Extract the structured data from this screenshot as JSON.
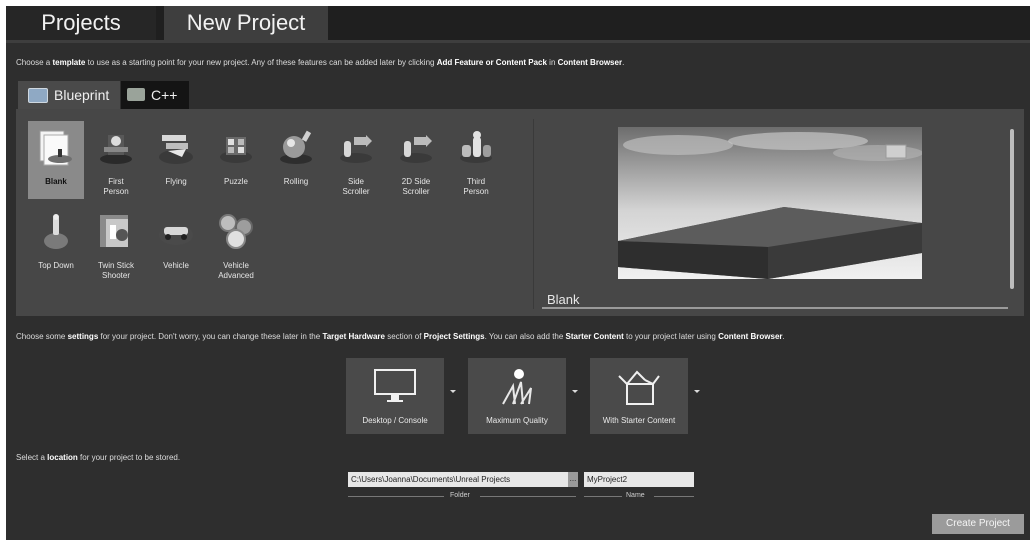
{
  "tabs": {
    "projects": "Projects",
    "new_project": "New Project"
  },
  "template_instruction": {
    "pre": "Choose a ",
    "b1": "template",
    "mid": " to use as a starting point for your new project.  Any of these features can be added later by clicking ",
    "b2": "Add Feature or Content Pack",
    "mid2": " in ",
    "b3": "Content Browser",
    "post": "."
  },
  "template_tabs": {
    "blueprint": "Blueprint",
    "cpp": "C++"
  },
  "templates": {
    "blank": {
      "line1": "Blank",
      "line2": ""
    },
    "first_person": {
      "line1": "First",
      "line2": "Person"
    },
    "flying": {
      "line1": "Flying",
      "line2": ""
    },
    "puzzle": {
      "line1": "Puzzle",
      "line2": ""
    },
    "rolling": {
      "line1": "Rolling",
      "line2": ""
    },
    "side_scroller": {
      "line1": "Side",
      "line2": "Scroller"
    },
    "side_scroller_2d": {
      "line1": "2D Side",
      "line2": "Scroller"
    },
    "third_person": {
      "line1": "Third",
      "line2": "Person"
    },
    "top_down": {
      "line1": "Top Down",
      "line2": ""
    },
    "twin_stick": {
      "line1": "Twin Stick",
      "line2": "Shooter"
    },
    "vehicle": {
      "line1": "Vehicle",
      "line2": ""
    },
    "vehicle_advanced": {
      "line1": "Vehicle",
      "line2": "Advanced"
    }
  },
  "selected_template": "Blank",
  "preview_title": "Blank",
  "settings_instruction": {
    "pre": "Choose some ",
    "b1": "settings",
    "mid": " for your project.  Don't worry, you can change these later in the ",
    "b2": "Target Hardware",
    "mid2": " section of ",
    "b3": "Project Settings",
    "mid3": ".  You can also add the ",
    "b4": "Starter Content",
    "mid4": " to your project later using ",
    "b5": "Content Browser",
    "post": "."
  },
  "settings": {
    "platform": "Desktop / Console",
    "quality": "Maximum Quality",
    "content": "With Starter Content"
  },
  "location_instruction": {
    "pre": "Select a ",
    "b1": "location",
    "post": " for your project to be stored."
  },
  "location": {
    "folder_value": "C:\\Users\\Joanna\\Documents\\Unreal Projects",
    "browse_label": "...",
    "folder_caption": "Folder",
    "name_value": "MyProject2",
    "name_caption": "Name"
  },
  "create_button": "Create Project",
  "icons": {
    "blueprint_tab": "blueprint-icon",
    "cpp_tab": "cpp-icon",
    "platform": "monitor-icon",
    "quality": "sun-grass-icon",
    "content": "open-box-icon"
  }
}
